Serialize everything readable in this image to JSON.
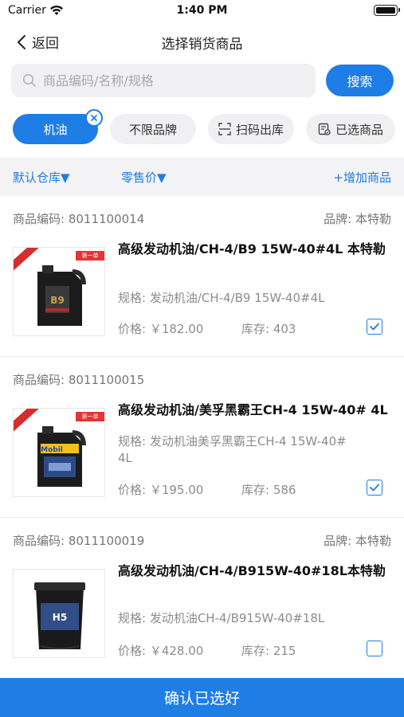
{
  "status": {
    "carrier": "Carrier",
    "time": "1:40 PM"
  },
  "nav": {
    "back_label": "返回",
    "title": "选择销货商品"
  },
  "search": {
    "placeholder": "商品编码/名称/规格",
    "button_label": "搜索"
  },
  "chips": {
    "oil": "机油",
    "any_brand": "不限品牌",
    "scan": "扫码出库",
    "selected": "已选商品"
  },
  "filters": {
    "warehouse": "默认仓库▼",
    "price_type": "零售价▼",
    "add_product": "+增加商品"
  },
  "products": [
    {
      "code": "商品编码: 8011100014",
      "brand": "品牌: 本特勒",
      "name": "高级发动机油/CH-4/B9 15W-40#4L 本特勒",
      "spec": "规格: 发动机油/CH-4/B9 15W-40#4L",
      "price": "价格: ￥182.00",
      "stock": "库存: 403",
      "checked": true,
      "image_label": "B9",
      "tag": "第一单"
    },
    {
      "code": "商品编码: 8011100015",
      "brand": "",
      "name": "高级发动机油/美孚黑霸王CH-4 15W-40#  4L",
      "spec": "规格: 发动机油美孚黑霸王CH-4 15W-40#  4L",
      "price": "价格: ￥195.00",
      "stock": "库存: 586",
      "checked": true,
      "image_label": "Mobil",
      "tag": "第一单"
    },
    {
      "code": "商品编码: 8011100019",
      "brand": "品牌: 本特勒",
      "name": "高级发动机油/CH-4/B915W-40#18L本特勒",
      "spec": "规格: 发动机油CH-4/B915W-40#18L",
      "price": "价格: ￥428.00",
      "stock": "库存: 215",
      "checked": false,
      "image_label": "H5",
      "tag": ""
    }
  ],
  "confirm_label": "确认已选好",
  "colors": {
    "accent": "#1f7de6",
    "muted": "#8c8c8c",
    "chip_bg": "#f0f0f2"
  }
}
